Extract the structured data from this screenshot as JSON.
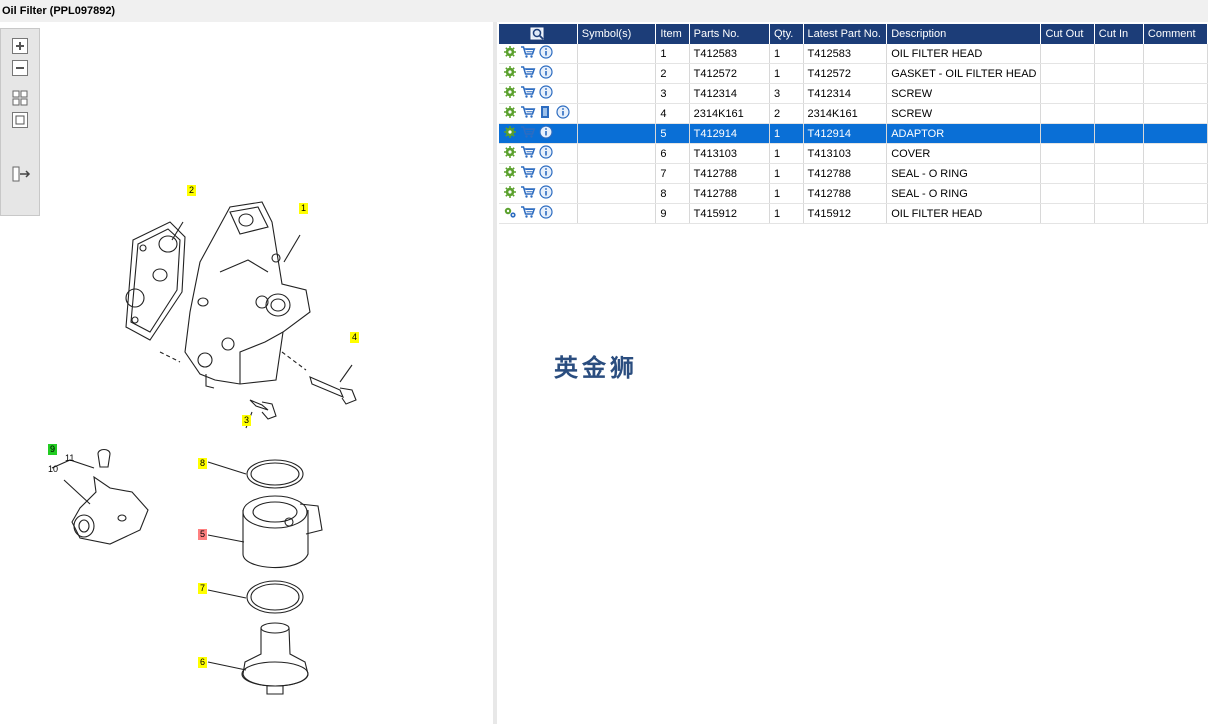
{
  "window": {
    "title": "Oil Filter (PPL097892)"
  },
  "toolbar": {
    "icons": [
      "zoom-in-icon",
      "zoom-out-icon",
      "fit-all-icon",
      "fit-window-icon",
      "export-icon"
    ]
  },
  "table": {
    "columns": [
      "",
      "Symbol(s)",
      "Item",
      "Parts No.",
      "Qty.",
      "Latest Part No.",
      "Description",
      "Cut Out",
      "Cut In",
      "Comment"
    ],
    "rows": [
      {
        "item": "1",
        "part_no": "T412583",
        "qty": "1",
        "latest": "T412583",
        "desc": "OIL FILTER HEAD",
        "cut_out": "",
        "cut_in": "",
        "comment": ""
      },
      {
        "item": "2",
        "part_no": "T412572",
        "qty": "1",
        "latest": "T412572",
        "desc": "GASKET - OIL FILTER HEAD",
        "cut_out": "",
        "cut_in": "",
        "comment": ""
      },
      {
        "item": "3",
        "part_no": "T412314",
        "qty": "3",
        "latest": "T412314",
        "desc": "SCREW",
        "cut_out": "",
        "cut_in": "",
        "comment": ""
      },
      {
        "item": "4",
        "part_no": "2314K161",
        "qty": "2",
        "latest": "2314K161",
        "desc": "SCREW",
        "cut_out": "",
        "cut_in": "",
        "comment": ""
      },
      {
        "item": "5",
        "part_no": "T412914",
        "qty": "1",
        "latest": "T412914",
        "desc": "ADAPTOR",
        "cut_out": "",
        "cut_in": "",
        "comment": ""
      },
      {
        "item": "6",
        "part_no": "T413103",
        "qty": "1",
        "latest": "T413103",
        "desc": "COVER",
        "cut_out": "",
        "cut_in": "",
        "comment": ""
      },
      {
        "item": "7",
        "part_no": "T412788",
        "qty": "1",
        "latest": "T412788",
        "desc": "SEAL - O RING",
        "cut_out": "",
        "cut_in": "",
        "comment": ""
      },
      {
        "item": "8",
        "part_no": "T412788",
        "qty": "1",
        "latest": "T412788",
        "desc": "SEAL - O RING",
        "cut_out": "",
        "cut_in": "",
        "comment": ""
      },
      {
        "item": "9",
        "part_no": "T415912",
        "qty": "1",
        "latest": "T415912",
        "desc": "OIL FILTER HEAD",
        "cut_out": "",
        "cut_in": "",
        "comment": ""
      }
    ],
    "selected_index": 4
  },
  "watermark": "英金狮",
  "diagram": {
    "callouts": [
      "1",
      "2",
      "3",
      "4",
      "5",
      "6",
      "7",
      "8",
      "9",
      "10",
      "11"
    ]
  },
  "colors": {
    "header_bg": "#1c3d78",
    "selected_row": "#0a6fd6",
    "callout_yellow": "#ffff00",
    "callout_green": "#22cc22",
    "callout_red": "#ff8080"
  }
}
